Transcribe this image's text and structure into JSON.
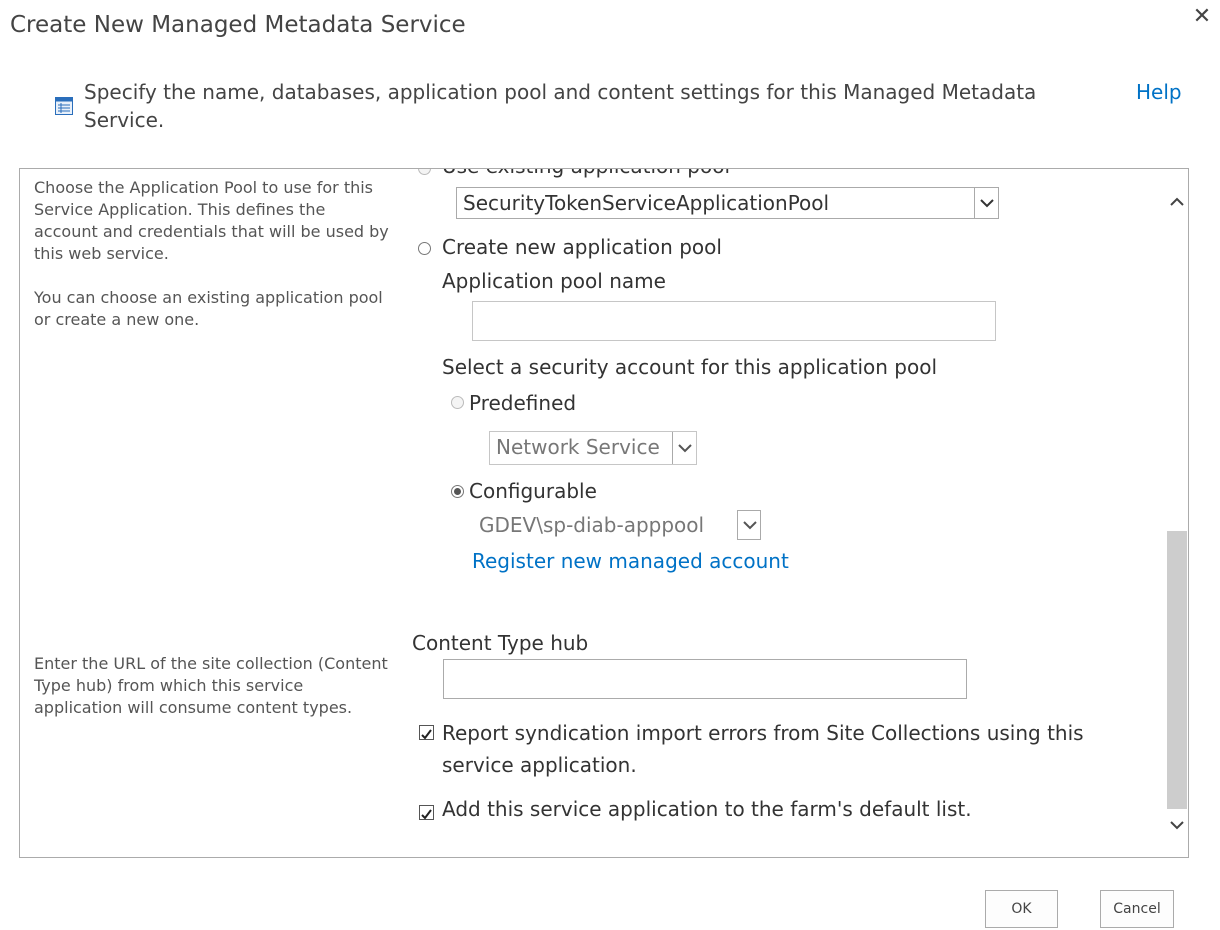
{
  "dialog": {
    "title": "Create New Managed Metadata Service",
    "close_icon": "close-icon",
    "intro_text": "Specify the name, databases, application pool and content settings for this Managed Metadata Service.",
    "intro_icon": "list-page-icon",
    "help_link": "Help"
  },
  "app_pool_section": {
    "description_1": "Choose the Application Pool to use for this Service Application.  This defines the account and credentials that will be used by this web service.",
    "description_2": "You can choose an existing application pool or create a new one.",
    "use_existing_label": "Use existing application pool",
    "existing_pool_value": "SecurityTokenServiceApplicationPool",
    "create_new_label": "Create new application pool",
    "pool_name_label": "Application pool name",
    "pool_name_value": "",
    "security_account_label": "Select a security account for this application pool",
    "predefined_label": "Predefined",
    "predefined_value": "Network Service",
    "configurable_label": "Configurable",
    "configurable_value": "GDEV\\sp-diab-apppool",
    "register_link": "Register new managed account"
  },
  "content_type_section": {
    "description": "Enter the URL of the site collection (Content Type hub) from which this service application will consume content types.",
    "hub_label": "Content Type hub",
    "hub_value": "",
    "report_errors_label": "Report syndication import errors from Site Collections using this service application.",
    "report_errors_checked": true,
    "add_default_label": "Add this service application to the farm's default list.",
    "add_default_checked": true
  },
  "buttons": {
    "ok": "OK",
    "cancel": "Cancel"
  },
  "colors": {
    "link": "#0072c6",
    "text": "#444444",
    "border": "#ababab"
  }
}
